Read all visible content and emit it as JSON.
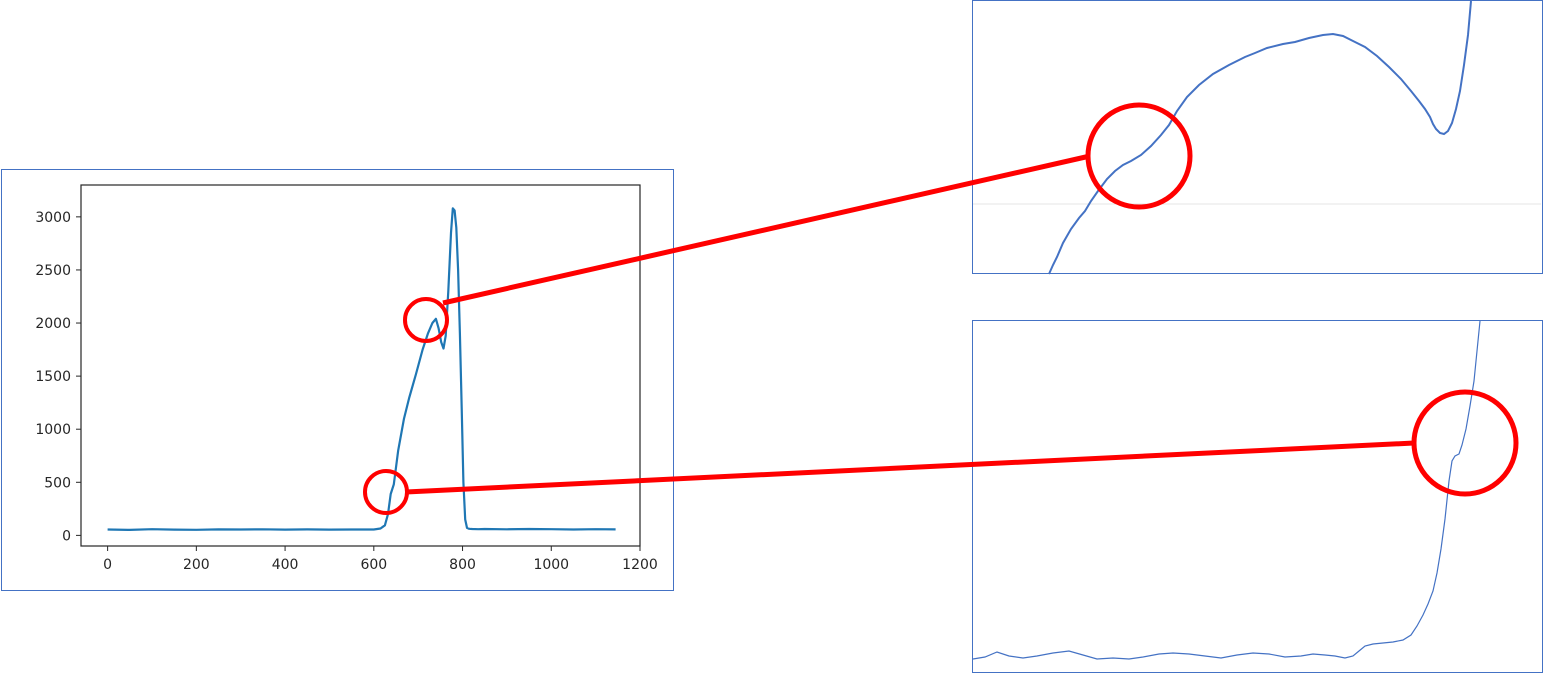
{
  "chart_data": [
    {
      "type": "line",
      "title": "",
      "xlabel": "",
      "ylabel": "",
      "xlim": [
        -60,
        1200
      ],
      "ylim": [
        -100,
        3300
      ],
      "xticks": [
        0,
        200,
        400,
        600,
        800,
        1000,
        1200
      ],
      "yticks": [
        0,
        500,
        1000,
        1500,
        2000,
        2500,
        3000
      ],
      "grid": false,
      "series": [
        {
          "color": "#1f77b4",
          "x": [
            0,
            50,
            100,
            150,
            200,
            250,
            300,
            350,
            400,
            450,
            500,
            550,
            600,
            615,
            625,
            632,
            638,
            645,
            655,
            668,
            680,
            695,
            710,
            722,
            732,
            740,
            746,
            752,
            757,
            762,
            768,
            774,
            778,
            782,
            786,
            790,
            794,
            798,
            802,
            806,
            810,
            815,
            822,
            835,
            850,
            900,
            950,
            1000,
            1050,
            1100,
            1145
          ],
          "y": [
            55,
            52,
            58,
            54,
            53,
            56,
            55,
            57,
            54,
            56,
            54,
            55,
            55,
            65,
            95,
            200,
            390,
            480,
            800,
            1100,
            1300,
            1520,
            1750,
            1900,
            2000,
            2040,
            1950,
            1820,
            1760,
            1880,
            2300,
            2850,
            3080,
            3060,
            2900,
            2500,
            1900,
            1200,
            500,
            150,
            70,
            62,
            60,
            58,
            60,
            57,
            60,
            58,
            55,
            58,
            56
          ]
        }
      ],
      "annotations": [
        {
          "shape": "circle",
          "x": 723,
          "y": 1970
        },
        {
          "shape": "circle",
          "x": 636,
          "y": 400
        }
      ]
    }
  ],
  "zoom_panels": [
    {
      "name": "zoom-of-peak-shoulder",
      "line_color": "#4472c4"
    },
    {
      "name": "zoom-of-rising-edge",
      "line_color": "#4472c4"
    }
  ],
  "colors": {
    "panel_border": "#4472c4",
    "callout": "#ff0000",
    "series": "#1f77b4"
  }
}
